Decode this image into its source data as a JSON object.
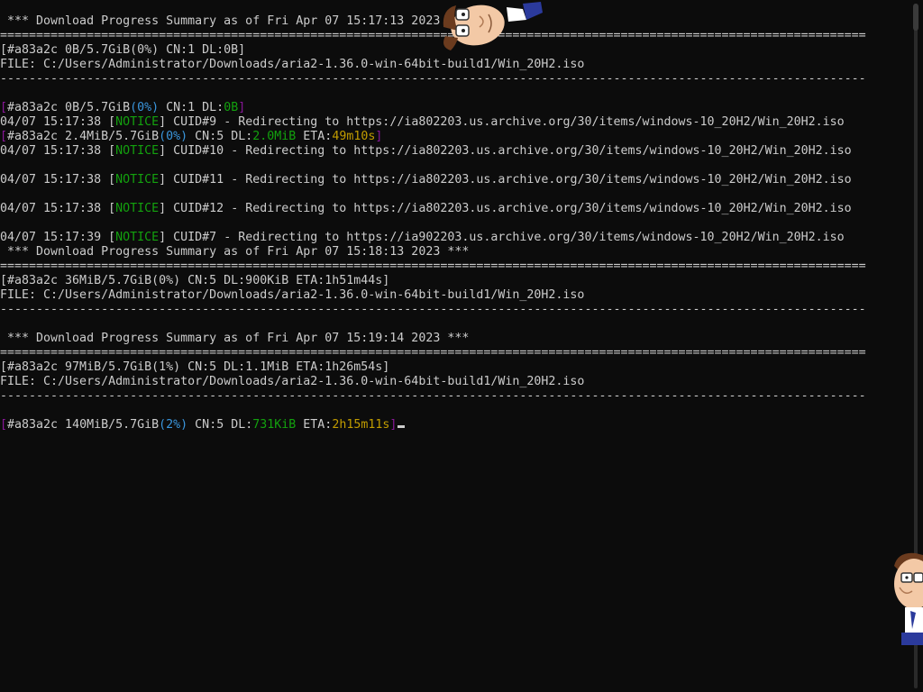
{
  "terminal": {
    "lines": [
      [
        {
          "t": " *** Download Progress Summary as of Fri Apr 07 15:17:13 2023 ***",
          "c": "default"
        }
      ],
      [
        {
          "t": "========================================================================================================================",
          "c": "default"
        }
      ],
      [
        {
          "t": "[#a83a2c 0B/5.7GiB(0%) CN:1 DL:0B]",
          "c": "default"
        }
      ],
      [
        {
          "t": "FILE: C:/Users/Administrator/Downloads/aria2-1.36.0-win-64bit-build1/Win_20H2.iso",
          "c": "default"
        }
      ],
      [
        {
          "t": "------------------------------------------------------------------------------------------------------------------------",
          "c": "default"
        }
      ],
      [
        {
          "t": "",
          "c": "default"
        }
      ],
      [
        {
          "t": "[",
          "c": "bracket"
        },
        {
          "t": "#a83a2c 0B/5.7GiB",
          "c": "default"
        },
        {
          "t": "(0%)",
          "c": "pct"
        },
        {
          "t": " CN:1 DL:",
          "c": "default"
        },
        {
          "t": "0B",
          "c": "green"
        },
        {
          "t": "]",
          "c": "bracket"
        }
      ],
      [
        {
          "t": "04/07 15:17:38 [",
          "c": "default"
        },
        {
          "t": "NOTICE",
          "c": "green"
        },
        {
          "t": "] CUID#9 - Redirecting to https://ia802203.us.archive.org/30/items/windows-10_20H2/Win_20H2.iso",
          "c": "default"
        }
      ],
      [
        {
          "t": "[",
          "c": "bracket"
        },
        {
          "t": "#a83a2c 2.4MiB/5.7GiB",
          "c": "default"
        },
        {
          "t": "(0%)",
          "c": "pct"
        },
        {
          "t": " CN:5 DL:",
          "c": "default"
        },
        {
          "t": "2.0MiB",
          "c": "green"
        },
        {
          "t": " ETA:",
          "c": "default"
        },
        {
          "t": "49m10s",
          "c": "eta"
        },
        {
          "t": "]",
          "c": "bracket"
        }
      ],
      [
        {
          "t": "04/07 15:17:38 [",
          "c": "default"
        },
        {
          "t": "NOTICE",
          "c": "green"
        },
        {
          "t": "] CUID#10 - Redirecting to https://ia802203.us.archive.org/30/items/windows-10_20H2/Win_20H2.iso",
          "c": "default"
        }
      ],
      [
        {
          "t": "",
          "c": "default"
        }
      ],
      [
        {
          "t": "04/07 15:17:38 [",
          "c": "default"
        },
        {
          "t": "NOTICE",
          "c": "green"
        },
        {
          "t": "] CUID#11 - Redirecting to https://ia802203.us.archive.org/30/items/windows-10_20H2/Win_20H2.iso",
          "c": "default"
        }
      ],
      [
        {
          "t": "",
          "c": "default"
        }
      ],
      [
        {
          "t": "04/07 15:17:38 [",
          "c": "default"
        },
        {
          "t": "NOTICE",
          "c": "green"
        },
        {
          "t": "] CUID#12 - Redirecting to https://ia802203.us.archive.org/30/items/windows-10_20H2/Win_20H2.iso",
          "c": "default"
        }
      ],
      [
        {
          "t": "",
          "c": "default"
        }
      ],
      [
        {
          "t": "04/07 15:17:39 [",
          "c": "default"
        },
        {
          "t": "NOTICE",
          "c": "green"
        },
        {
          "t": "] CUID#7 - Redirecting to https://ia902203.us.archive.org/30/items/windows-10_20H2/Win_20H2.iso",
          "c": "default"
        }
      ],
      [
        {
          "t": " *** Download Progress Summary as of Fri Apr 07 15:18:13 2023 ***",
          "c": "default"
        }
      ],
      [
        {
          "t": "========================================================================================================================",
          "c": "default"
        }
      ],
      [
        {
          "t": "[#a83a2c 36MiB/5.7GiB(0%) CN:5 DL:900KiB ETA:1h51m44s]",
          "c": "default"
        }
      ],
      [
        {
          "t": "FILE: C:/Users/Administrator/Downloads/aria2-1.36.0-win-64bit-build1/Win_20H2.iso",
          "c": "default"
        }
      ],
      [
        {
          "t": "------------------------------------------------------------------------------------------------------------------------",
          "c": "default"
        }
      ],
      [
        {
          "t": "",
          "c": "default"
        }
      ],
      [
        {
          "t": " *** Download Progress Summary as of Fri Apr 07 15:19:14 2023 ***",
          "c": "default"
        }
      ],
      [
        {
          "t": "========================================================================================================================",
          "c": "default"
        }
      ],
      [
        {
          "t": "[#a83a2c 97MiB/5.7GiB(1%) CN:5 DL:1.1MiB ETA:1h26m54s]",
          "c": "default"
        }
      ],
      [
        {
          "t": "FILE: C:/Users/Administrator/Downloads/aria2-1.36.0-win-64bit-build1/Win_20H2.iso",
          "c": "default"
        }
      ],
      [
        {
          "t": "------------------------------------------------------------------------------------------------------------------------",
          "c": "default"
        }
      ],
      [
        {
          "t": "",
          "c": "default"
        }
      ],
      [
        {
          "t": "[",
          "c": "bracket"
        },
        {
          "t": "#a83a2c 140MiB/5.7GiB",
          "c": "default"
        },
        {
          "t": "(2%)",
          "c": "pct"
        },
        {
          "t": " CN:5 DL:",
          "c": "default"
        },
        {
          "t": "731KiB",
          "c": "green"
        },
        {
          "t": " ETA:",
          "c": "default"
        },
        {
          "t": "2h15m11s",
          "c": "eta"
        },
        {
          "t": "]",
          "c": "bracket"
        }
      ]
    ]
  },
  "colors": {
    "background": "#0c0c0c",
    "default": "#cccccc",
    "bracket": "#881798",
    "pct": "#3a96dd",
    "green": "#13a10e",
    "eta": "#c19c00"
  },
  "overlays": {
    "top_icon": "cartoon-character-icon",
    "right_icon": "cartoon-character-icon"
  }
}
